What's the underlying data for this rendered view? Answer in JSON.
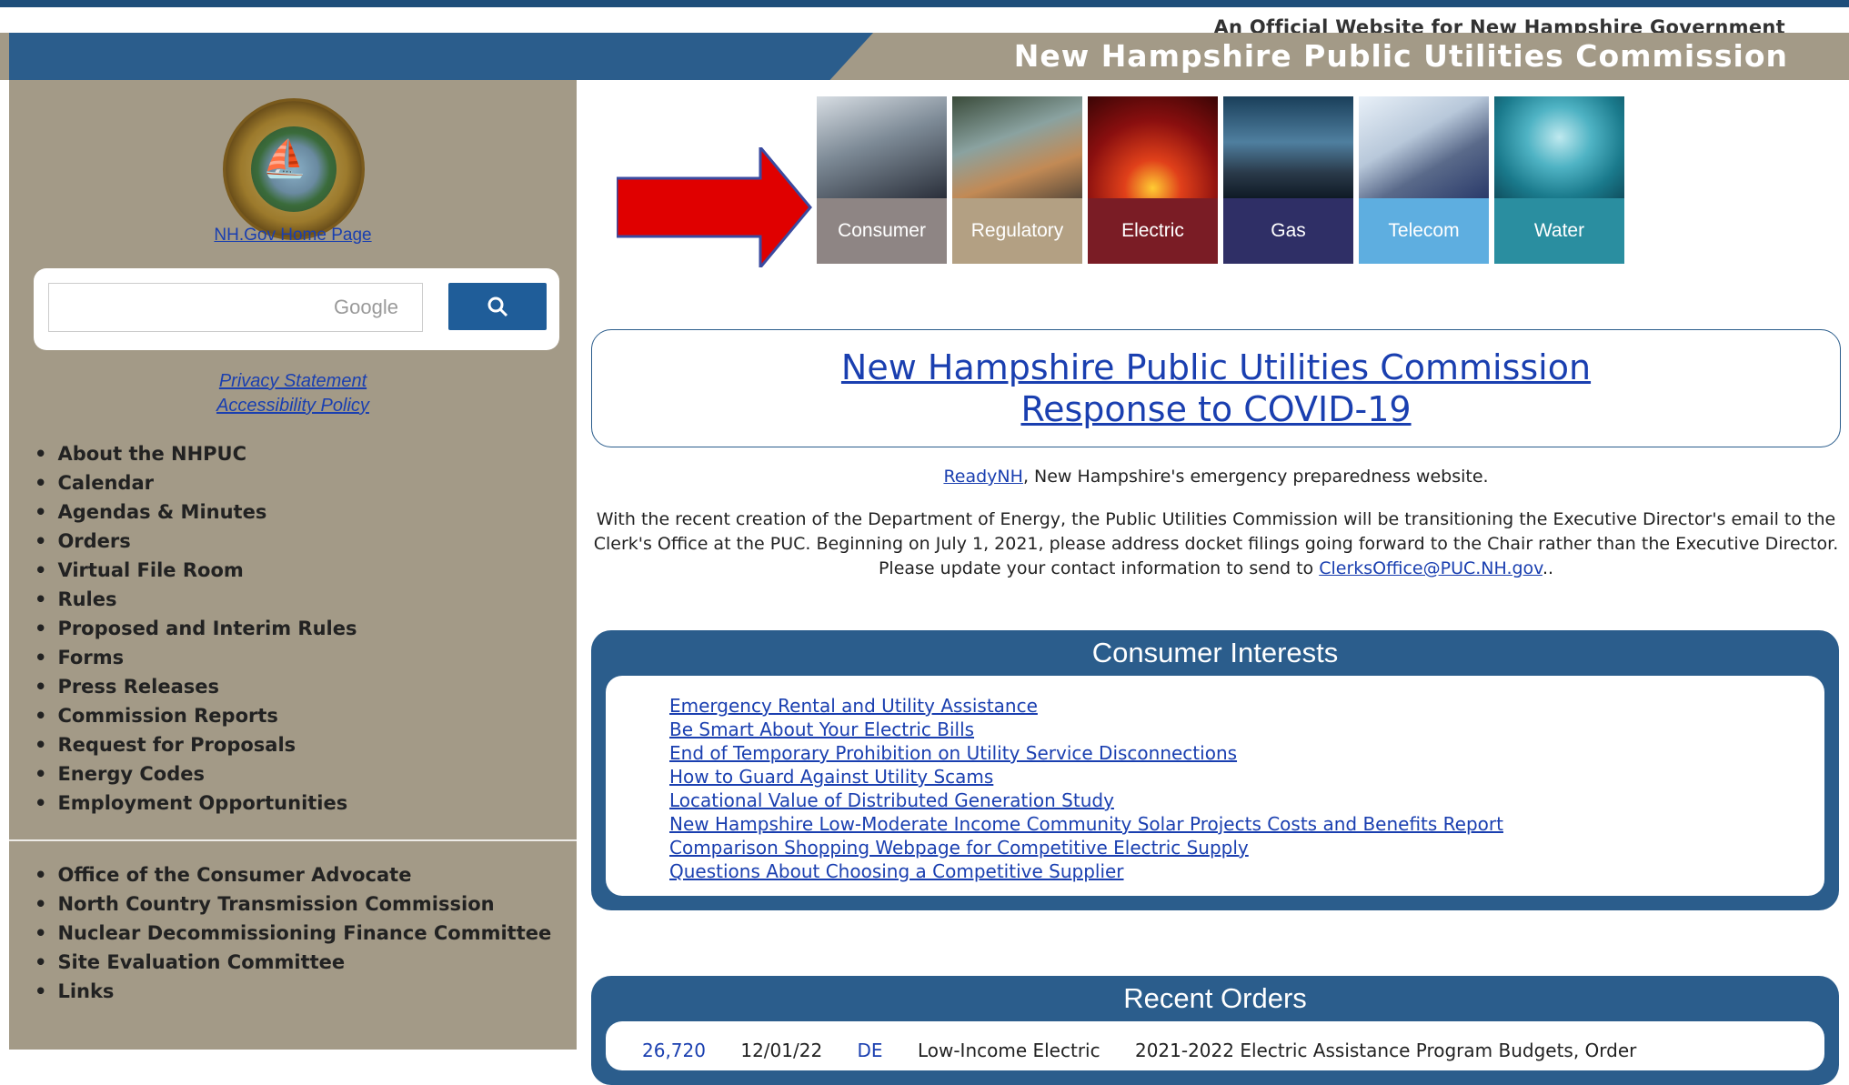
{
  "header": {
    "official_text": "An Official Website for New Hampshire Government",
    "title": "New Hampshire Public Utilities Commission"
  },
  "sidebar": {
    "seal_icon": "nh-state-seal",
    "home_link": "NH.Gov Home Page",
    "search": {
      "placeholder": "Google",
      "button_icon": "search-icon"
    },
    "privacy": "Privacy Statement",
    "accessibility": "Accessibility Policy",
    "nav_primary": [
      "About the NHPUC",
      "Calendar",
      "Agendas & Minutes",
      "Orders",
      "Virtual File Room",
      "Rules",
      "Proposed and Interim Rules",
      "Forms",
      "Press Releases",
      "Commission Reports",
      "Request for Proposals",
      "Energy Codes",
      "Employment Opportunities"
    ],
    "nav_secondary": [
      "Office of the Consumer Advocate",
      "North Country Transmission Commission",
      "Nuclear Decommissioning Finance Committee",
      "Site Evaluation Committee",
      "Links"
    ]
  },
  "tiles": [
    {
      "label": "Consumer",
      "color": "#8e8584"
    },
    {
      "label": "Regulatory",
      "color": "#b3a083"
    },
    {
      "label": "Electric",
      "color": "#7a1c25"
    },
    {
      "label": "Gas",
      "color": "#2f2f66"
    },
    {
      "label": "Telecom",
      "color": "#5eaee0"
    },
    {
      "label": "Water",
      "color": "#2a8ea0"
    }
  ],
  "main": {
    "covid_line1": "New Hampshire Public Utilities Commission",
    "covid_line2": "Response to COVID-19",
    "ready_link": "ReadyNH",
    "ready_text": ", New Hampshire's emergency preparedness website.",
    "notice_text": "With the recent creation of the Department of Energy, the Public Utilities Commission will be transitioning the Executive Director's email to the Clerk's Office at the PUC. Beginning on July 1, 2021, please address docket filings going forward to the Chair rather than the Executive Director. Please update your contact information to send to ",
    "notice_email": "ClerksOffice@PUC.NH.gov",
    "notice_end": "..",
    "consumer_title": "Consumer Interests",
    "consumer_links": [
      "Emergency Rental and Utility Assistance",
      "Be Smart About Your Electric Bills",
      "End of Temporary Prohibition on Utility Service Disconnections",
      "How to Guard Against Utility Scams",
      "Locational Value of Distributed Generation Study",
      "New Hampshire Low-Moderate Income Community Solar Projects Costs and Benefits Report",
      "Comparison Shopping Webpage for Competitive Electric Supply",
      "Questions About Choosing a Competitive Supplier"
    ],
    "orders_title": "Recent Orders",
    "orders_row": [
      "26,720",
      "12/01/22",
      "DE",
      "Low-Income Electric",
      "2021-2022 Electric Assistance Program Budgets, Order"
    ]
  }
}
